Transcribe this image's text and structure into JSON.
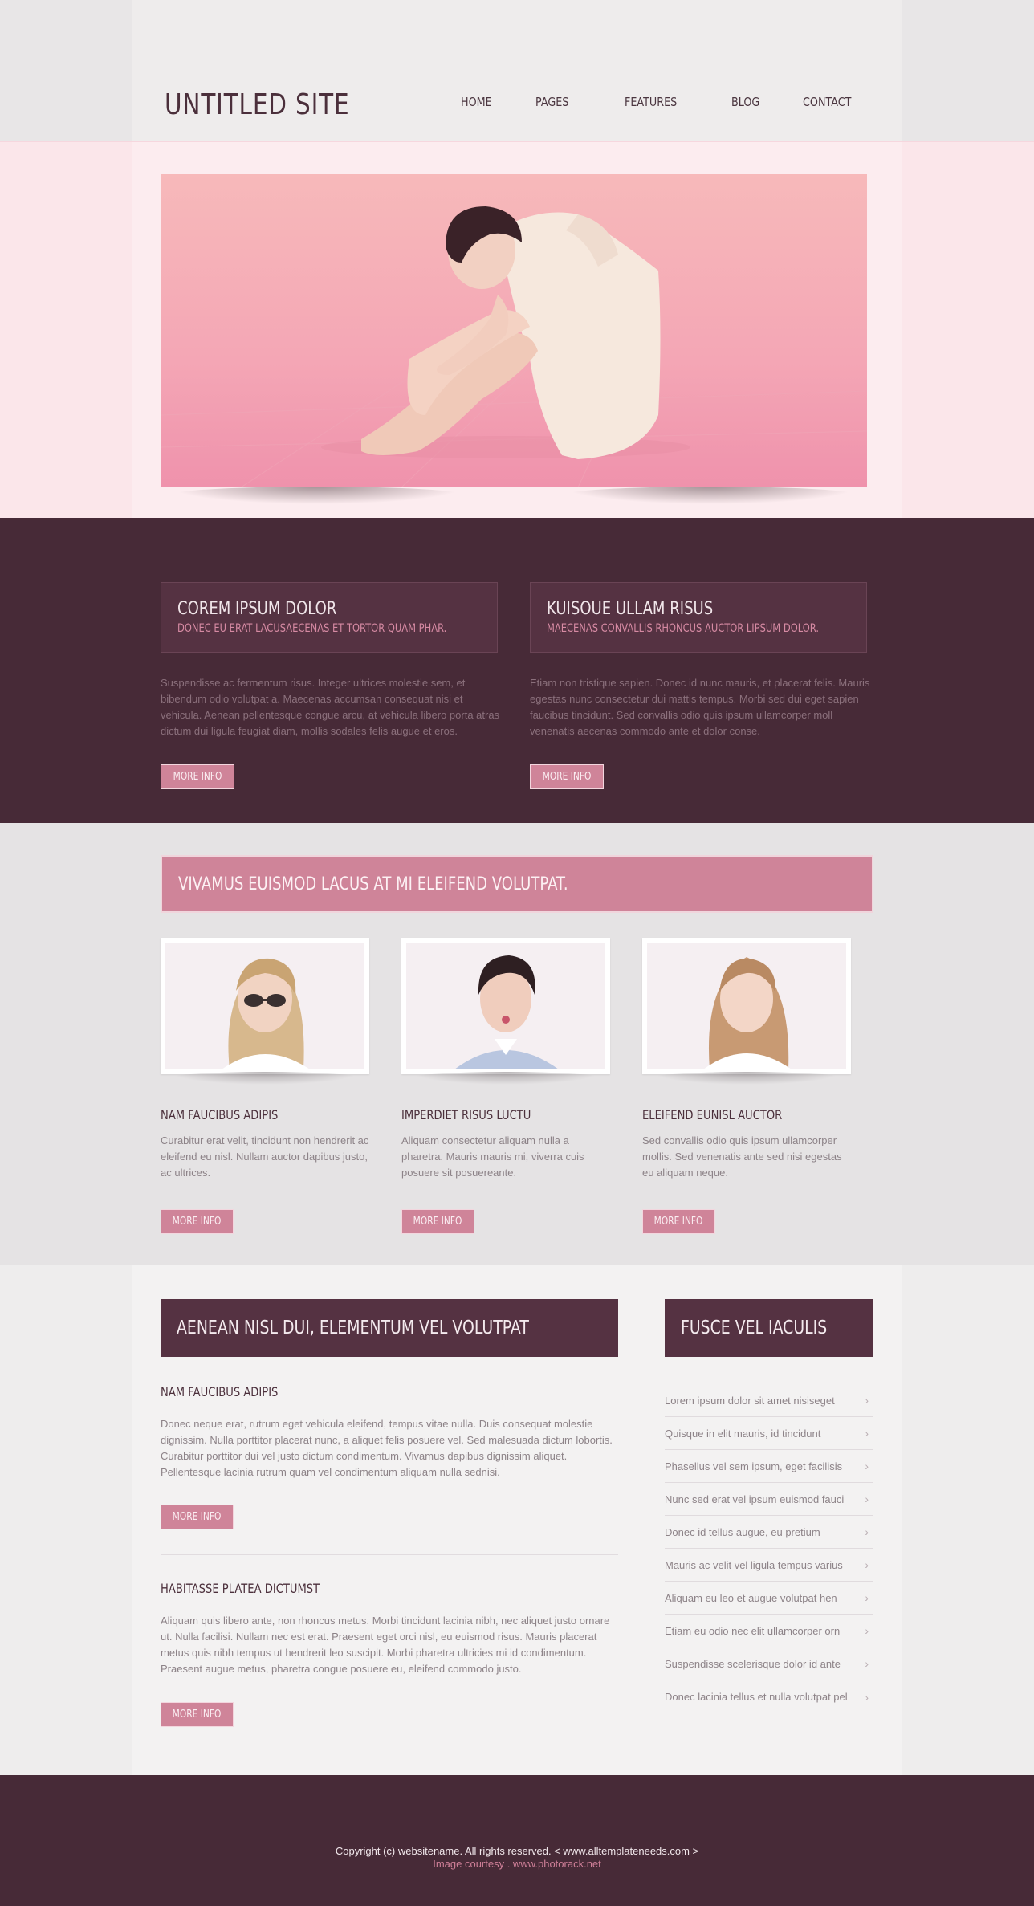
{
  "site": {
    "logo": "UNTITLED SITE"
  },
  "nav": {
    "items": [
      "HOME",
      "PAGES",
      "FEATURES",
      "BLOG",
      "CONTACT"
    ]
  },
  "featured": [
    {
      "title": "COREM IPSUM DOLOR",
      "subtitle": "DONEC EU ERAT LACUSAECENAS ET TORTOR QUAM PHAR.",
      "text": "Suspendisse ac fermentum risus. Integer ultrices molestie sem, et bibendum odio volutpat a. Maecenas accumsan consequat nisi et vehicula. Aenean pellentesque congue arcu, at vehicula libero porta atras dictum dui ligula feugiat diam, mollis sodales felis augue et eros.",
      "button": "MORE INFO"
    },
    {
      "title": "KUISOUE ULLAM RISUS",
      "subtitle": "MAECENAS CONVALLIS RHONCUS AUCTOR LIPSUM DOLOR.",
      "text": "Etiam non tristique sapien. Donec id nunc mauris, et placerat felis. Mauris egestas nunc consectetur dui mattis tempus. Morbi sed dui eget sapien faucibus tincidunt. Sed convallis odio quis ipsum ullamcorper moll venenatis aecenas commodo ante et dolor conse.",
      "button": "MORE INFO"
    }
  ],
  "banner": {
    "text": "VIVAMUS EUISMOD LACUS AT MI ELEIFEND VOLUTPAT."
  },
  "cards": [
    {
      "title": "NAM FAUCIBUS ADIPIS",
      "text": "Curabitur erat velit, tincidunt non hendrerit ac eleifend eu nisl. Nullam auctor dapibus justo, ac ultrices.",
      "button": "MORE INFO"
    },
    {
      "title": "IMPERDIET RISUS LUCTU",
      "text": "Aliquam consectetur aliquam nulla a pharetra. Mauris mauris mi, viverra cuis posuere sit posuereante.",
      "button": "MORE INFO"
    },
    {
      "title": "ELEIFEND EUNISL AUCTOR",
      "text": "Sed convallis odio quis ipsum ullamcorper mollis. Sed venenatis ante sed nisi egestas eu aliquam neque.",
      "button": "MORE INFO"
    }
  ],
  "main": {
    "heading": "AENEAN NISL DUI, ELEMENTUM VEL VOLUTPAT",
    "articles": [
      {
        "title": "NAM FAUCIBUS ADIPIS",
        "text": "Donec neque erat, rutrum eget vehicula eleifend, tempus vitae nulla. Duis consequat molestie dignissim. Nulla porttitor placerat nunc, a aliquet felis posuere vel. Sed malesuada dictum lobortis. Curabitur porttitor dui vel justo dictum condimentum. Vivamus dapibus dignissim aliquet. Pellentesque lacinia rutrum quam vel condimentum aliquam nulla sednisi.",
        "button": "MORE INFO"
      },
      {
        "title": "HABITASSE PLATEA DICTUMST",
        "text": "Aliquam quis libero ante, non rhoncus metus. Morbi tincidunt lacinia nibh, nec aliquet justo ornare ut. Nulla facilisi. Nullam nec est erat. Praesent eget orci nisl, eu euismod risus. Mauris placerat metus quis nibh tempus ut hendrerit leo suscipit. Morbi pharetra ultricies mi id condimentum. Praesent augue metus, pharetra congue posuere eu, eleifend commodo justo.",
        "button": "MORE INFO"
      }
    ]
  },
  "sidebar": {
    "heading": "FUSCE VEL IACULIS",
    "items": [
      "Lorem ipsum dolor sit amet nisiseget",
      "Quisque in elit mauris, id tincidunt",
      "Phasellus vel sem ipsum, eget facilisis",
      "Nunc sed erat vel ipsum euismod fauci",
      "Donec id tellus augue, eu pretium",
      "Mauris ac velit vel ligula tempus varius",
      "Aliquam eu leo et augue volutpat hen",
      "Etiam eu odio nec elit ullamcorper orn",
      "Suspendisse scelerisque dolor id ante",
      "Donec lacinia tellus et nulla volutpat pel"
    ]
  },
  "footer": {
    "copyright": "Copyright (c) websitename. All rights reserved. < www.alltemplateneeds.com >",
    "credit": "Image courtesy . www.photorack.net"
  },
  "colors": {
    "brand_dark": "#472a37",
    "accent_pink": "#cf8499",
    "hero_pink": "#fbe6ea"
  }
}
